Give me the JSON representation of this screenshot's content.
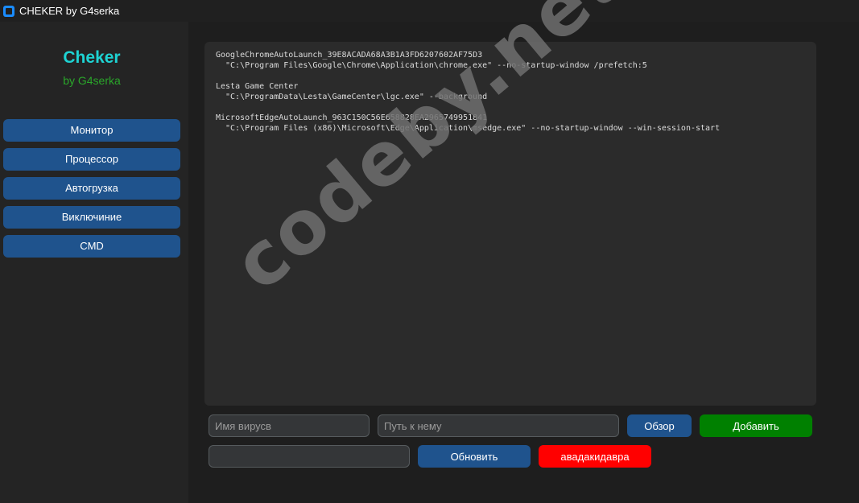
{
  "window": {
    "title": "CHEKER by G4serka",
    "accent_color": "#1a8cff"
  },
  "sidebar": {
    "logo": "Cheker",
    "logo_sub": "by G4serka",
    "items": [
      {
        "label": "Монитор"
      },
      {
        "label": "Процессор"
      },
      {
        "label": "Автогрузка"
      },
      {
        "label": "Виключиние"
      },
      {
        "label": "CMD"
      }
    ]
  },
  "output": {
    "entries": [
      {
        "name": "GoogleChromeAutoLaunch_39E8ACADA68A3B1A3FD6207602AF75D3",
        "command": "\"C:\\Program Files\\Google\\Chrome\\Application\\chrome.exe\" --no-startup-window /prefetch:5"
      },
      {
        "name": "Lesta Game Center",
        "command": "\"C:\\ProgramData\\Lesta\\GameCenter\\lgc.exe\" --background"
      },
      {
        "name": "MicrosoftEdgeAutoLaunch_963C150C56E658828EA2965749951841",
        "command": "\"C:\\Program Files (x86)\\Microsoft\\Edge\\Application\\msedge.exe\" --no-startup-window --win-session-start"
      }
    ]
  },
  "controls": {
    "virus_name_placeholder": "Имя вирусв",
    "path_placeholder": "Путь к нему",
    "browse_label": "Обзор",
    "add_label": "Добавить",
    "command_value": "",
    "refresh_label": "Обновить",
    "kill_label": "авадакидавра"
  },
  "colors": {
    "button_blue": "#1f538d",
    "button_green": "#008000",
    "button_red": "#ff0000"
  },
  "watermark": "codeby.net"
}
